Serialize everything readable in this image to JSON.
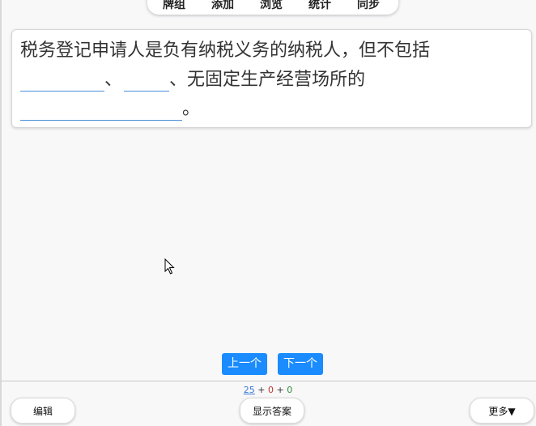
{
  "top_menu": {
    "items": [
      "牌组",
      "添加",
      "浏览",
      "统计",
      "同步"
    ]
  },
  "question": {
    "line1": "税务登记申请人是负有纳税义务的纳税人，但不包括",
    "sep1": "、",
    "sep2": "、无固定生产经营场所的",
    "end": "。"
  },
  "nav": {
    "prev": "上一个",
    "next": "下一个"
  },
  "counts": {
    "new": "25",
    "plus1": " + ",
    "learning": "0",
    "plus2": " + ",
    "review": "0"
  },
  "bottom": {
    "edit": "编辑",
    "show_answer": "显示答案",
    "more": "更多▼"
  },
  "colors": {
    "primary": "#1a8cff",
    "blank_line": "#4a90d9",
    "new_count": "#3a78d6",
    "learning_count": "#c0392b",
    "review_count": "#2e8b3a"
  }
}
